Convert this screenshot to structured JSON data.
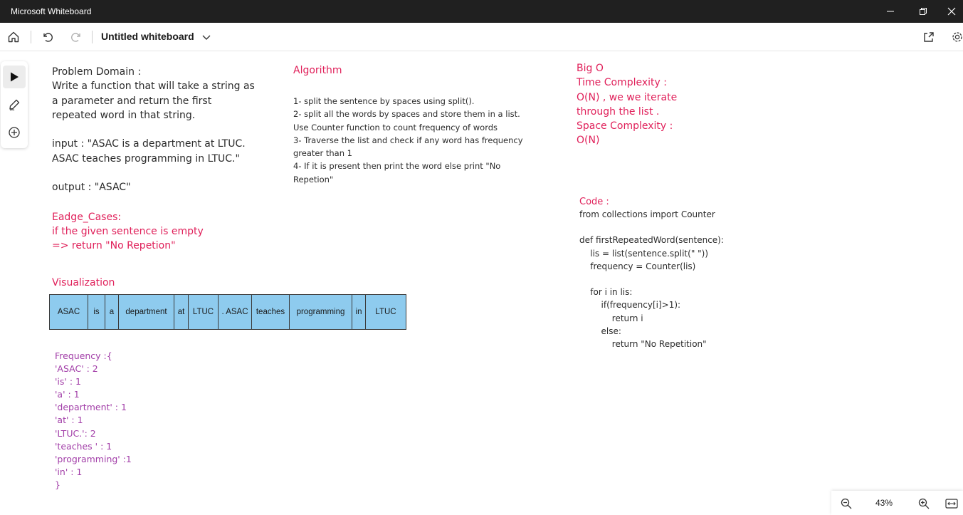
{
  "window": {
    "title": "Microsoft Whiteboard"
  },
  "toolbar": {
    "board_title": "Untitled whiteboard"
  },
  "canvas": {
    "problem": "Problem Domain :\nWrite a function that will take a string as\na parameter and return the first\nrepeated word in that string.\n\ninput : \"ASAC is a department at LTUC.\nASAC teaches programming in LTUC.\"\n\noutput : \"ASAC\"",
    "edge_title": "Eadge_Cases:",
    "edge_body": "if the given sentence is empty\n=> return \"No Repetion\"",
    "viz_title": "Visualization",
    "viz_cells": [
      "ASAC",
      "is",
      "a",
      "department",
      "at",
      "LTUC",
      ". ASAC",
      "teaches",
      "programming",
      "in",
      "LTUC"
    ],
    "frequency": "Frequency :{\n'ASAC' : 2\n'is' : 1\n'a' : 1\n'department' : 1\n'at' : 1\n'LTUC.': 2\n'teaches ' : 1\n'programming' :1\n'in' : 1\n}",
    "algo_title": "Algorithm",
    "algo_body": "1- split the sentence by spaces using split().\n2- split all the words by spaces and store them in a list.\nUse Counter function to count frequency of words\n3- Traverse the list and check if any word has frequency\ngreater than 1\n4- If it is present then print the word else print \"No\nRepetion\"",
    "bigo": "Big O\nTime Complexity :\nO(N) , we we iterate\nthrough the list .\nSpace Complexity :\nO(N)",
    "code_title": "Code :",
    "code_body": "from collections import Counter\n\ndef firstRepeatedWord(sentence):\n    lis = list(sentence.split(\" \"))\n    frequency = Counter(lis)\n\n    for i in lis:\n        if(frequency[i]>1):\n            return i\n        else:\n            return \"No Repetition\""
  },
  "zoom": {
    "level": "43%"
  },
  "colors": {
    "titlebar": "#202020",
    "pink": "#e0205a",
    "purple": "#a23ea8",
    "cell": "#8ecbee"
  }
}
